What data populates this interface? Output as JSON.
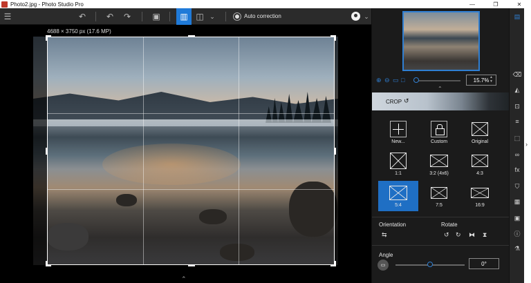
{
  "window": {
    "title": "Photo2.jpg - Photo Studio Pro",
    "controls": {
      "minimize": "—",
      "maximize": "❐",
      "close": "✕"
    }
  },
  "toolbar": {
    "menu_icon": "☰",
    "undo_icon": "↶",
    "undo_alt_icon": "↶",
    "redo_icon": "↷",
    "save_icon": "▣",
    "view_single_icon": "▥",
    "view_compare_icon": "◫",
    "view_dropdown_icon": "⌄",
    "auto_correction_label": "Auto correction",
    "user_dropdown_icon": "⌄"
  },
  "canvas": {
    "image_info": "4688 × 3750 px (17.6 MP)",
    "expand_caret": "⌃"
  },
  "panel": {
    "zoom": {
      "value": "15.7%",
      "zoom_in_icon": "⊕",
      "zoom_out_icon": "⊖",
      "fit_icon": "▭",
      "actual_icon": "□",
      "slider_level": 0.05,
      "spin_up": "▲",
      "spin_down": "▼"
    },
    "collapse_caret": "⌃",
    "crop": {
      "title": "CROP",
      "reset_icon": "↺"
    },
    "presets": [
      {
        "label": "New...",
        "icon": "plus-icon",
        "selected": false
      },
      {
        "label": "Custom",
        "icon": "lock-icon",
        "selected": false
      },
      {
        "label": "Original",
        "icon": "image-icon",
        "selected": false
      },
      {
        "label": "1:1",
        "icon": "ratio-icon",
        "selected": false
      },
      {
        "label": "3:2 (4x6)",
        "icon": "ratio-icon",
        "selected": false
      },
      {
        "label": "4:3",
        "icon": "ratio-icon",
        "selected": false
      },
      {
        "label": "5:4",
        "icon": "ratio-icon",
        "selected": true
      },
      {
        "label": "7:5",
        "icon": "ratio-icon",
        "selected": false
      },
      {
        "label": "16:9",
        "icon": "ratio-icon",
        "selected": false
      }
    ],
    "orientation": {
      "label": "Orientation",
      "swap_icon": "⇆"
    },
    "rotate": {
      "label": "Rotate",
      "ccw_icon": "↺",
      "cw_icon": "↻",
      "flip_h_icon": "⧓",
      "flip_v_icon": "⧗"
    },
    "angle": {
      "label": "Angle",
      "icon_text": "▭",
      "value": "0°",
      "slider_level": 0.5
    }
  },
  "sidestrip": {
    "icons": [
      "layers-icon",
      "eraser-icon",
      "adjust-icon",
      "crop-icon",
      "sliders-icon",
      "selection-icon",
      "glasses-icon",
      "fx-icon",
      "stamp-icon",
      "texture-icon",
      "frame-icon",
      "info-icon",
      "flask-icon"
    ],
    "glyphs": [
      "▤",
      "⌫",
      "◭",
      "⊡",
      "≡",
      "⬚",
      "∞",
      "fx",
      "⛉",
      "▦",
      "▣",
      "ⓘ",
      "⚗"
    ]
  },
  "edge": {
    "arrow": "›"
  },
  "colors": {
    "accent": "#1f7ad8",
    "selected_preset": "#1f6fc4",
    "panel_bg": "#1b1b1b"
  }
}
